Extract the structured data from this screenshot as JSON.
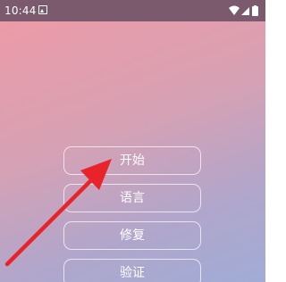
{
  "status_bar": {
    "time": "10:44",
    "icons": [
      "notification-icon",
      "wifi-icon",
      "cell-signal-icon",
      "battery-icon"
    ]
  },
  "menu": {
    "buttons": [
      {
        "label": "开始"
      },
      {
        "label": "语言"
      },
      {
        "label": "修复"
      },
      {
        "label": "验证"
      }
    ]
  },
  "annotation": {
    "arrow_color": "#e8232a",
    "points_to": "开始"
  },
  "colors": {
    "status_bar_bg": "#7a5a6c",
    "background_top": "#ef9aa5",
    "background_bottom": "#a0acd6",
    "button_border": "#ffffff"
  }
}
